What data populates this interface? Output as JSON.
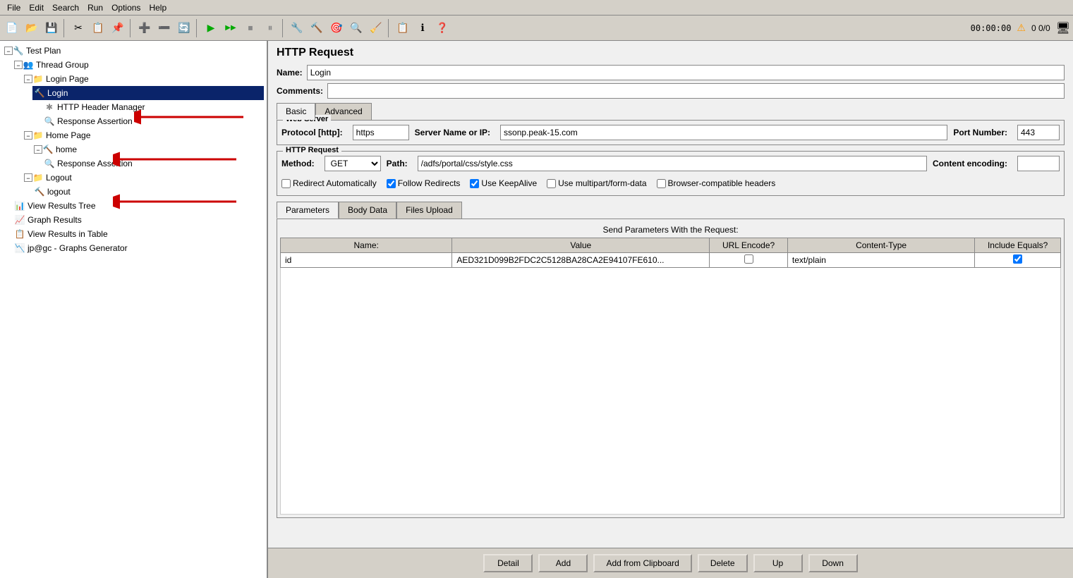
{
  "menu": {
    "items": [
      "File",
      "Edit",
      "Search",
      "Run",
      "Options",
      "Help"
    ]
  },
  "toolbar": {
    "buttons": [
      {
        "name": "new-button",
        "icon": "📄",
        "label": "New"
      },
      {
        "name": "open-button",
        "icon": "📂",
        "label": "Open"
      },
      {
        "name": "save-button",
        "icon": "💾",
        "label": "Save"
      },
      {
        "name": "cut-button",
        "icon": "✂",
        "label": "Cut"
      },
      {
        "name": "copy-button",
        "icon": "📋",
        "label": "Copy"
      },
      {
        "name": "paste-button",
        "icon": "📌",
        "label": "Paste"
      }
    ],
    "timer": "00:00:00",
    "warning": "▲",
    "counts": "0  0/0"
  },
  "tree": {
    "items": [
      {
        "id": "test-plan",
        "label": "Test Plan",
        "indent": 0,
        "icon": "🔧",
        "toggle": "−"
      },
      {
        "id": "thread-group",
        "label": "Thread Group",
        "indent": 1,
        "icon": "👥",
        "toggle": "−"
      },
      {
        "id": "login-page",
        "label": "Login Page",
        "indent": 2,
        "icon": "📁",
        "toggle": "−"
      },
      {
        "id": "login",
        "label": "Login",
        "indent": 3,
        "icon": "🔨",
        "toggle": "",
        "selected": true
      },
      {
        "id": "http-header",
        "label": "HTTP Header Manager",
        "indent": 4,
        "icon": "✱",
        "toggle": ""
      },
      {
        "id": "response-assertion-1",
        "label": "Response Assertion",
        "indent": 4,
        "icon": "🔍",
        "toggle": ""
      },
      {
        "id": "home-page",
        "label": "Home Page",
        "indent": 2,
        "icon": "📁",
        "toggle": "−"
      },
      {
        "id": "home",
        "label": "home",
        "indent": 3,
        "icon": "🔨",
        "toggle": "−"
      },
      {
        "id": "response-assertion-2",
        "label": "Response Assertion",
        "indent": 4,
        "icon": "🔍",
        "toggle": ""
      },
      {
        "id": "logout",
        "label": "Logout",
        "indent": 2,
        "icon": "📁",
        "toggle": "−"
      },
      {
        "id": "logout-item",
        "label": "logout",
        "indent": 3,
        "icon": "🔨",
        "toggle": ""
      },
      {
        "id": "view-results-tree",
        "label": "View Results Tree",
        "indent": 1,
        "icon": "📊",
        "toggle": ""
      },
      {
        "id": "graph-results",
        "label": "Graph Results",
        "indent": 1,
        "icon": "📈",
        "toggle": ""
      },
      {
        "id": "view-results-table",
        "label": "View Results in Table",
        "indent": 1,
        "icon": "📋",
        "toggle": ""
      },
      {
        "id": "graphs-generator",
        "label": "jp@gc - Graphs Generator",
        "indent": 1,
        "icon": "📉",
        "toggle": ""
      }
    ]
  },
  "http_request": {
    "title": "HTTP Request",
    "name_label": "Name:",
    "name_value": "Login",
    "comments_label": "Comments:",
    "comments_value": "",
    "tabs": {
      "basic": "Basic",
      "advanced": "Advanced"
    },
    "web_server": {
      "label": "Web Server",
      "protocol_label": "Protocol [http]:",
      "protocol_value": "https",
      "server_label": "Server Name or IP:",
      "server_value": "ssonp.peak-15.com",
      "port_label": "Port Number:",
      "port_value": "443"
    },
    "http_request_section": {
      "label": "HTTP Request",
      "method_label": "Method:",
      "method_value": "GET",
      "path_label": "Path:",
      "path_value": "/adfs/portal/css/style.css",
      "encoding_label": "Content encoding:",
      "encoding_value": ""
    },
    "checkboxes": {
      "redirect_auto": {
        "label": "Redirect Automatically",
        "checked": false
      },
      "follow_redirects": {
        "label": "Follow Redirects",
        "checked": true
      },
      "keep_alive": {
        "label": "Use KeepAlive",
        "checked": true
      },
      "multipart": {
        "label": "Use multipart/form-data",
        "checked": false
      },
      "browser_compat": {
        "label": "Browser-compatible headers",
        "checked": false
      }
    },
    "params_tabs": [
      "Parameters",
      "Body Data",
      "Files Upload"
    ],
    "send_params_text": "Send Parameters With the Request:",
    "table": {
      "headers": [
        "Name:",
        "Value",
        "URL Encode?",
        "Content-Type",
        "Include Equals?"
      ],
      "rows": [
        {
          "name": "id",
          "value": "AED321D099B2FDC2C5128BA28CA2E94107FE610...",
          "url_encode": false,
          "content_type": "text/plain",
          "include_equals": true
        }
      ]
    },
    "buttons": {
      "detail": "Detail",
      "add": "Add",
      "add_from_clipboard": "Add from Clipboard",
      "delete": "Delete",
      "up": "Up",
      "down": "Down"
    }
  }
}
